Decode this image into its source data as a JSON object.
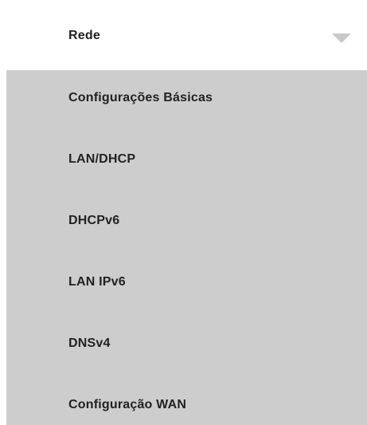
{
  "menu": {
    "header": {
      "label": "Rede",
      "icon": "chevron-down-icon"
    },
    "items": [
      {
        "label": "Configurações Básicas"
      },
      {
        "label": "LAN/DHCP"
      },
      {
        "label": "DHCPv6"
      },
      {
        "label": "LAN IPv6"
      },
      {
        "label": "DNSv4"
      },
      {
        "label": "Configuração WAN"
      }
    ],
    "colors": {
      "submenu_background": "#cdcdcd",
      "chevron": "#c8c8c8",
      "text": "#222222",
      "page_background": "#ffffff"
    }
  }
}
